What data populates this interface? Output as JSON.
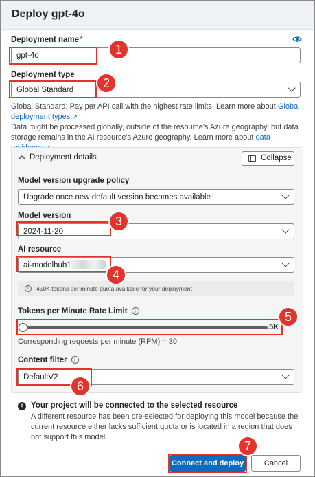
{
  "dialog": {
    "title": "Deploy gpt-4o"
  },
  "deployment_name": {
    "label": "Deployment name",
    "required_marker": "*",
    "value": "gpt-4o"
  },
  "deployment_type": {
    "label": "Deployment type",
    "value": "Global Standard",
    "help_line1": "Global Standard: Pay per API call with the highest rate limits. Learn more about",
    "help_link1": "Global deployment types",
    "help_line2": "Data might be processed globally, outside of the resource's Azure geography, but data storage remains in the AI resource's Azure geography. Learn more about",
    "help_link2": "data residency"
  },
  "details": {
    "title": "Deployment details",
    "collapse_label": "Collapse",
    "upgrade_policy": {
      "label": "Model version upgrade policy",
      "value": "Upgrade once new default version becomes available"
    },
    "model_version": {
      "label": "Model version",
      "value": "2024-11-20"
    },
    "ai_resource": {
      "label": "AI resource",
      "value": "ai-modelhub1"
    },
    "quota_note": "450K tokens per minute quota available for your deployment",
    "rate_limit": {
      "label": "Tokens per Minute Rate Limit",
      "value_label": "5K",
      "fraction": 0.0,
      "rpm_text": "Corresponding requests per minute (RPM) = 30"
    },
    "content_filter": {
      "label": "Content filter",
      "value": "DefaultV2"
    }
  },
  "notice": {
    "title": "Your project will be connected to the selected resource",
    "body": "A different resource has been pre-selected for deploying this model because the current resource either lacks sufficient quota or is located in a region that does not support this model."
  },
  "actions": {
    "primary": "Connect and deploy",
    "secondary": "Cancel"
  },
  "badges": [
    "1",
    "2",
    "3",
    "4",
    "5",
    "6",
    "7"
  ],
  "colors": {
    "accent": "#0f6cbd",
    "highlight": "#e5322d",
    "header_bg": "#eef1f6"
  }
}
